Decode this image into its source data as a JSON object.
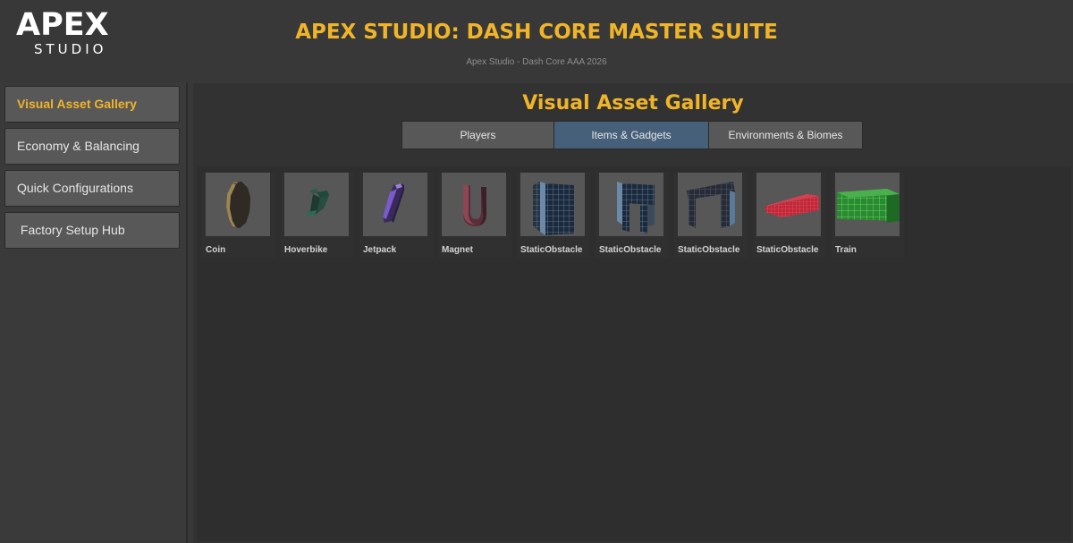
{
  "header": {
    "logo_main": "APEX",
    "logo_sub": "STUDIO",
    "title": "APEX STUDIO: DASH CORE MASTER SUITE",
    "subtitle": "Apex Studio - Dash Core AAA 2026"
  },
  "sidebar": {
    "items": [
      {
        "label": "Visual Asset Gallery",
        "active": true
      },
      {
        "label": "Economy & Balancing",
        "active": false
      },
      {
        "label": "Quick Configurations",
        "active": false
      },
      {
        "label": " Factory Setup Hub",
        "active": false
      }
    ]
  },
  "main": {
    "title": "Visual Asset Gallery",
    "tabs": [
      {
        "label": "Players",
        "active": false
      },
      {
        "label": "Items & Gadgets",
        "active": true
      },
      {
        "label": "Environments & Biomes",
        "active": false
      }
    ],
    "assets": [
      {
        "name": "Coin",
        "icon": "coin-icon"
      },
      {
        "name": "Hoverbike",
        "icon": "hoverbike-icon"
      },
      {
        "name": "Jetpack",
        "icon": "jetpack-icon"
      },
      {
        "name": "Magnet",
        "icon": "magnet-icon"
      },
      {
        "name": "StaticObstacle",
        "icon": "wall-obstacle-icon"
      },
      {
        "name": "StaticObstacle",
        "icon": "gate-obstacle-icon"
      },
      {
        "name": "StaticObstacle",
        "icon": "arch-obstacle-icon"
      },
      {
        "name": "StaticObstacle",
        "icon": "ramp-obstacle-icon"
      },
      {
        "name": "Train",
        "icon": "train-icon"
      }
    ]
  },
  "colors": {
    "accent": "#f0b429",
    "active_tab": "#46607a",
    "background": "#383838"
  }
}
